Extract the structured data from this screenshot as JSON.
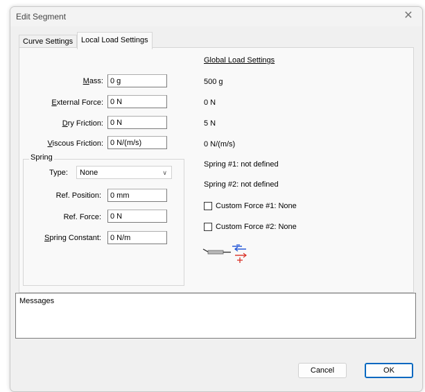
{
  "window": {
    "title": "Edit Segment"
  },
  "tabs": [
    {
      "label": "Curve Settings",
      "active": false
    },
    {
      "label": "Local Load Settings",
      "active": true
    }
  ],
  "local": {
    "mass": {
      "label_key": "M",
      "label_rest": "ass:",
      "value": "0 g"
    },
    "external_force": {
      "label_key": "E",
      "label_rest": "xternal Force:",
      "value": "0 N"
    },
    "dry_friction": {
      "label_key": "D",
      "label_rest": "ry Friction:",
      "value": "0 N"
    },
    "viscous_friction": {
      "label_key": "V",
      "label_rest": "iscous Friction:",
      "value": "0 N/(m/s)"
    }
  },
  "spring": {
    "group_title": "Spring",
    "type_label": "Type:",
    "type_value": "None",
    "ref_position": {
      "label": "Ref. Position:",
      "value": "0 mm"
    },
    "ref_force": {
      "label": "Ref. Force:",
      "value": "0 N"
    },
    "spring_constant": {
      "label_key": "S",
      "label_rest": "pring Constant:",
      "value": "0 N/m"
    }
  },
  "global": {
    "heading": "Global Load Settings",
    "mass": "500 g",
    "external_force": "0 N",
    "dry_friction": "5 N",
    "viscous_friction": "0 N/(m/s)",
    "spring1": "Spring #1: not defined",
    "spring2": "Spring #2: not defined",
    "custom_force1": {
      "label": "Custom Force #1: None",
      "checked": false
    },
    "custom_force2": {
      "label": "Custom Force #2: None",
      "checked": false
    }
  },
  "messages": {
    "title": "Messages"
  },
  "buttons": {
    "cancel": "Cancel",
    "ok": "OK"
  },
  "icons": {
    "close": "close-icon",
    "load_diagram": "load-diagram-icon"
  },
  "colors": {
    "accent": "#0067c0",
    "plus_red": "#d93025",
    "minus_blue": "#1a4fd6"
  }
}
